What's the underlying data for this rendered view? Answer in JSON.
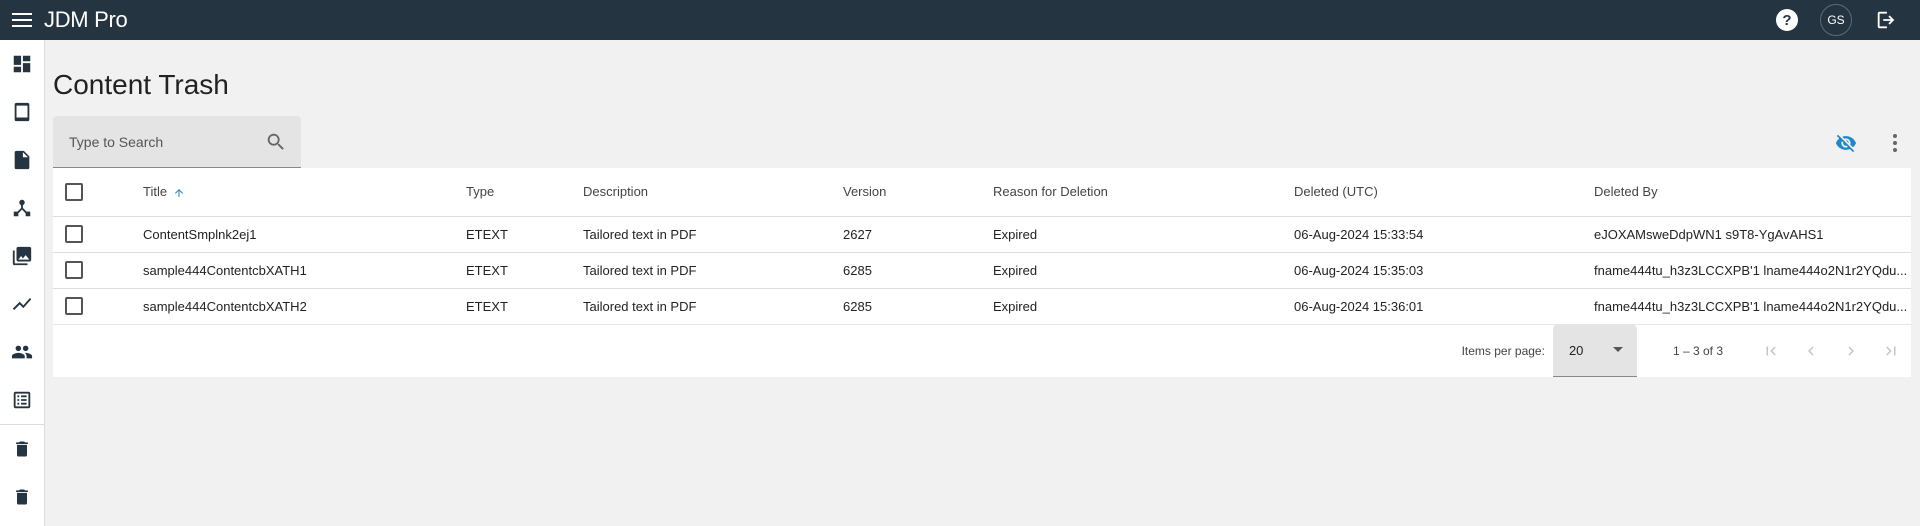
{
  "app": {
    "title": "JDM Pro",
    "user_initials": "GS",
    "help_symbol": "?"
  },
  "sidebar": {
    "items": [
      {
        "name": "dashboard-icon"
      },
      {
        "name": "tablet-icon"
      },
      {
        "name": "document-icon"
      },
      {
        "name": "workflow-icon"
      },
      {
        "name": "gallery-icon"
      },
      {
        "name": "analytics-icon"
      },
      {
        "name": "people-icon"
      },
      {
        "name": "list-icon"
      },
      {
        "name": "trash-icon"
      },
      {
        "name": "content-trash-icon"
      }
    ]
  },
  "page": {
    "title": "Content Trash"
  },
  "search": {
    "placeholder": "Type to Search"
  },
  "table": {
    "columns": [
      "Title",
      "Type",
      "Description",
      "Version",
      "Reason for Deletion",
      "Deleted (UTC)",
      "Deleted By"
    ],
    "sort_column": "Title",
    "sort_direction": "ascending",
    "rows": [
      {
        "title": "ContentSmplnk2ej1",
        "type": "ETEXT",
        "description": "Tailored text in PDF",
        "version": "2627",
        "reason": "Expired",
        "deleted": "06-Aug-2024 15:33:54",
        "deleted_by": "eJOXAMsweDdpWN1 s9T8-YgAvAHS1"
      },
      {
        "title": "sample444ContentcbXATH1",
        "type": "ETEXT",
        "description": "Tailored text in PDF",
        "version": "6285",
        "reason": "Expired",
        "deleted": "06-Aug-2024 15:35:03",
        "deleted_by": "fname444tu_h3z3LCCXPB'1 lname444o2N1r2YQdu..."
      },
      {
        "title": "sample444ContentcbXATH2",
        "type": "ETEXT",
        "description": "Tailored text in PDF",
        "version": "6285",
        "reason": "Expired",
        "deleted": "06-Aug-2024 15:36:01",
        "deleted_by": "fname444tu_h3z3LCCXPB'1 lname444o2N1r2YQdu..."
      }
    ]
  },
  "paginator": {
    "items_per_page_label": "Items per page:",
    "items_per_page": "20",
    "range_label": "1 – 3 of 3"
  },
  "colors": {
    "topbar": "#243441",
    "accent": "#1e88c8",
    "background": "#f1f1f1"
  }
}
